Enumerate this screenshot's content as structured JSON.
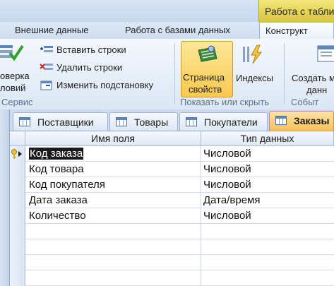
{
  "ribbon": {
    "context_group": "Работа с табли",
    "tabs": [
      {
        "label": "Внешние данные"
      },
      {
        "label": "Работа с базами данных"
      },
      {
        "label": "Конструкт"
      }
    ],
    "buttons": {
      "check_rules_line1": "оверка",
      "check_rules_line2": "ловий",
      "insert_rows": "Вставить строки",
      "delete_rows": "Удалить строки",
      "modify_lookup": "Изменить подстановку",
      "property_sheet_line1": "Страница",
      "property_sheet_line2": "свойств",
      "indexes": "Индексы",
      "create_line1": "Создать м",
      "create_line2": "данн"
    },
    "groups": {
      "service": "Сервис",
      "show_hide": "Показать или скрыть",
      "events": "Событ"
    }
  },
  "doc_tabs": [
    {
      "label": "Поставщики",
      "active": false
    },
    {
      "label": "Товары",
      "active": false
    },
    {
      "label": "Покупатели",
      "active": false
    },
    {
      "label": "Заказы",
      "active": true
    }
  ],
  "grid": {
    "headers": {
      "field_name": "Имя поля",
      "data_type": "Тип данных"
    },
    "rows": [
      {
        "field": "Код заказа",
        "type": "Числовой",
        "primary_key": true
      },
      {
        "field": "Код товара",
        "type": "Числовой",
        "primary_key": false
      },
      {
        "field": "Код покупателя",
        "type": "Числовой",
        "primary_key": false
      },
      {
        "field": "Дата заказа",
        "type": "Дата/время",
        "primary_key": false
      },
      {
        "field": "Количество",
        "type": "Числовой",
        "primary_key": false
      },
      {
        "field": "",
        "type": "",
        "primary_key": false
      },
      {
        "field": "",
        "type": "",
        "primary_key": false
      },
      {
        "field": "",
        "type": "",
        "primary_key": false
      },
      {
        "field": "",
        "type": "",
        "primary_key": false
      }
    ]
  }
}
